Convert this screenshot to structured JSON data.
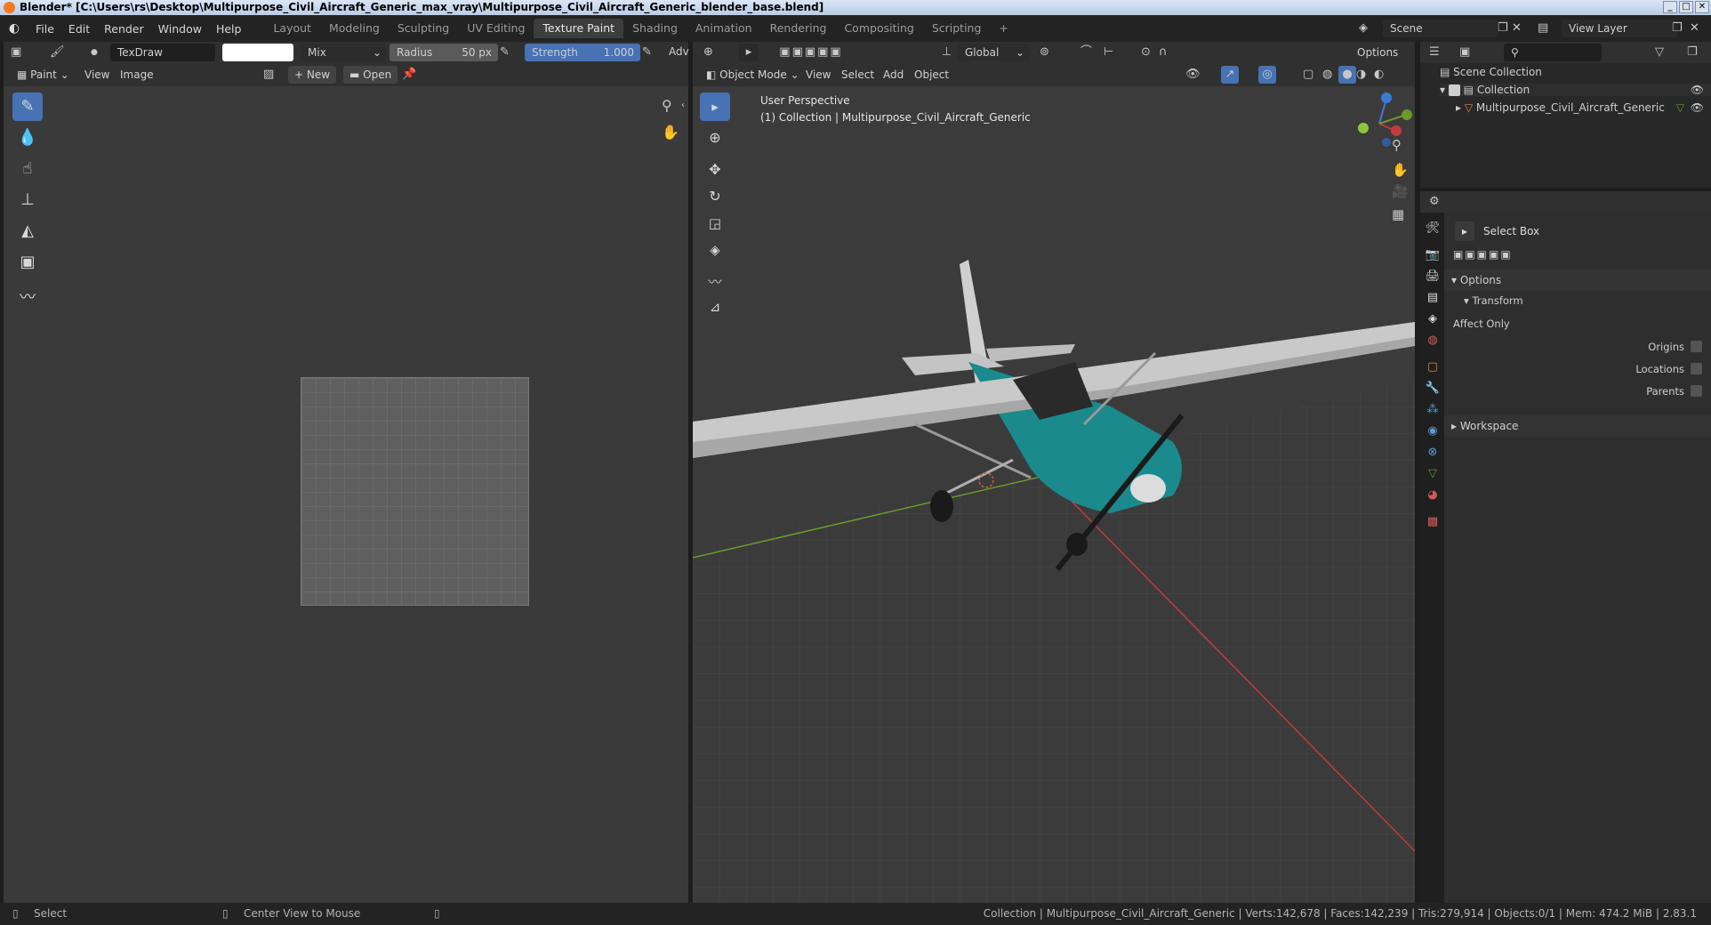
{
  "window": {
    "title": "Blender* [C:\\Users\\rs\\Desktop\\Multipurpose_Civil_Aircraft_Generic_max_vray\\Multipurpose_Civil_Aircraft_Generic_blender_base.blend]"
  },
  "menu": [
    "File",
    "Edit",
    "Render",
    "Window",
    "Help"
  ],
  "workspaces": [
    "Layout",
    "Modeling",
    "Sculpting",
    "UV Editing",
    "Texture Paint",
    "Shading",
    "Animation",
    "Rendering",
    "Compositing",
    "Scripting"
  ],
  "scene": {
    "name": "Scene",
    "view_layer": "View Layer"
  },
  "paint_header": {
    "brush": "TexDraw",
    "blend": "Mix",
    "radius_label": "Radius",
    "radius_value": "50 px",
    "strength_label": "Strength",
    "strength_value": "1.000",
    "adv": "Adv"
  },
  "image_editor": {
    "mode": "Paint",
    "view": "View",
    "image": "Image",
    "new": "New",
    "open": "Open"
  },
  "viewport_header": {
    "orientation": "Global",
    "options": "Options",
    "mode": "Object Mode",
    "view": "View",
    "select": "Select",
    "add": "Add",
    "object": "Object"
  },
  "viewport": {
    "perspective": "User Perspective",
    "collection_info": "(1) Collection | Multipurpose_Civil_Aircraft_Generic"
  },
  "outliner": {
    "scene_collection": "Scene Collection",
    "collection": "Collection",
    "object": "Multipurpose_Civil_Aircraft_Generic"
  },
  "properties": {
    "tool": "Select Box",
    "options": "Options",
    "transform": "Transform",
    "affect_only": "Affect Only",
    "origins": "Origins",
    "locations": "Locations",
    "parents": "Parents",
    "workspace": "Workspace"
  },
  "status": {
    "select": "Select",
    "center_view": "Center View to Mouse",
    "info": "Collection | Multipurpose_Civil_Aircraft_Generic | Verts:142,678 | Faces:142,239 | Tris:279,914 | Objects:0/1 | Mem: 474.2 MiB | 2.83.1"
  },
  "colors": {
    "accent": "#4772b3",
    "aircraft_body": "#1a8a8c",
    "wing": "#c9c9c9",
    "x_axis": "#c23b3b",
    "y_axis": "#6a9a2a",
    "z_axis": "#3a7bd5"
  }
}
